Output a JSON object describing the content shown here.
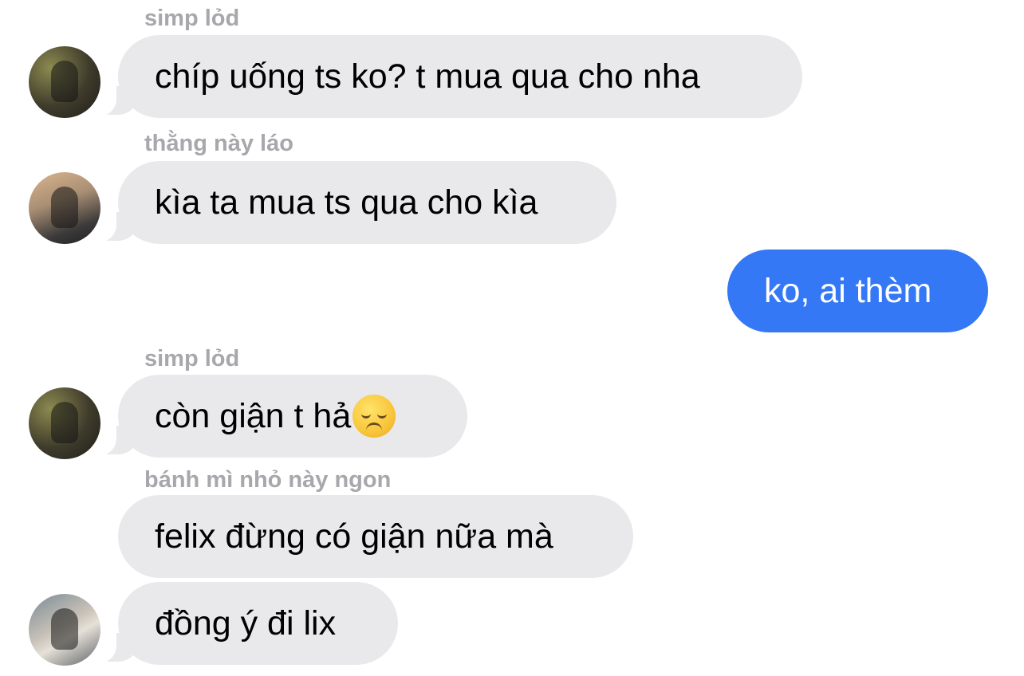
{
  "messages": [
    {
      "type": "incoming",
      "sender": "simp lỏd",
      "text": "chíp uống ts ko? t mua qua cho nha",
      "avatar": "avatar-1"
    },
    {
      "type": "incoming",
      "sender": "thằng này láo",
      "text": "kìa ta mua ts qua cho kìa",
      "avatar": "avatar-2"
    },
    {
      "type": "outgoing",
      "text": "ko, ai thèm"
    },
    {
      "type": "incoming",
      "sender": "simp lỏd",
      "text": "còn giận t hả",
      "emoji": "disappointed-face-emoji",
      "avatar": "avatar-1"
    },
    {
      "type": "incoming",
      "sender": "bánh mì nhỏ này ngon",
      "text": "felix đừng có giận nữa mà"
    },
    {
      "type": "incoming",
      "text": "đồng ý đi lix",
      "avatar": "avatar-3"
    }
  ],
  "colors": {
    "incoming_bubble": "#e9e9eb",
    "outgoing_bubble": "#3478f6",
    "sender_name": "#a7a7ac",
    "background": "#ffffff"
  }
}
